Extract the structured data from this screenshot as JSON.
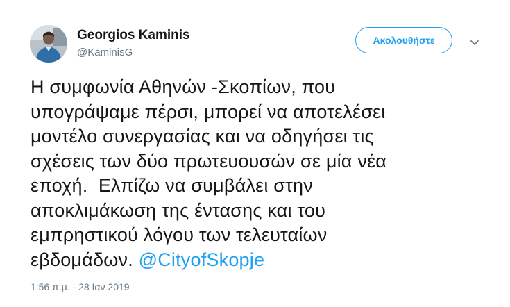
{
  "author": {
    "display_name": "Georgios Kaminis",
    "handle": "@KaminisG"
  },
  "follow_button_label": "Ακολουθήστε",
  "tweet": {
    "lines": [
      "Η συμφωνία Αθηνών -Σκοπίων, που",
      "υπογράψαμε πέρσι, μπορεί να αποτελέσει",
      "μοντέλο συνεργασίας και να οδηγήσει τις",
      "σχέσεις των δύο πρωτευουσών σε μία νέα",
      "εποχή.  Ελπίζω να συμβάλει στην",
      "αποκλιμάκωση της έντασης και του",
      "εμπρηστικού λόγου των τελευταίων",
      "εβδομάδων. "
    ],
    "mention": "@CityofSkopje"
  },
  "timestamp": "1:56 π.μ. - 28 Ιαν 2019",
  "icons": {
    "avatar": "profile-photo",
    "more": "chevron-down-icon"
  },
  "colors": {
    "accent": "#1da1f2",
    "text": "#14171a",
    "secondary": "#657786"
  }
}
